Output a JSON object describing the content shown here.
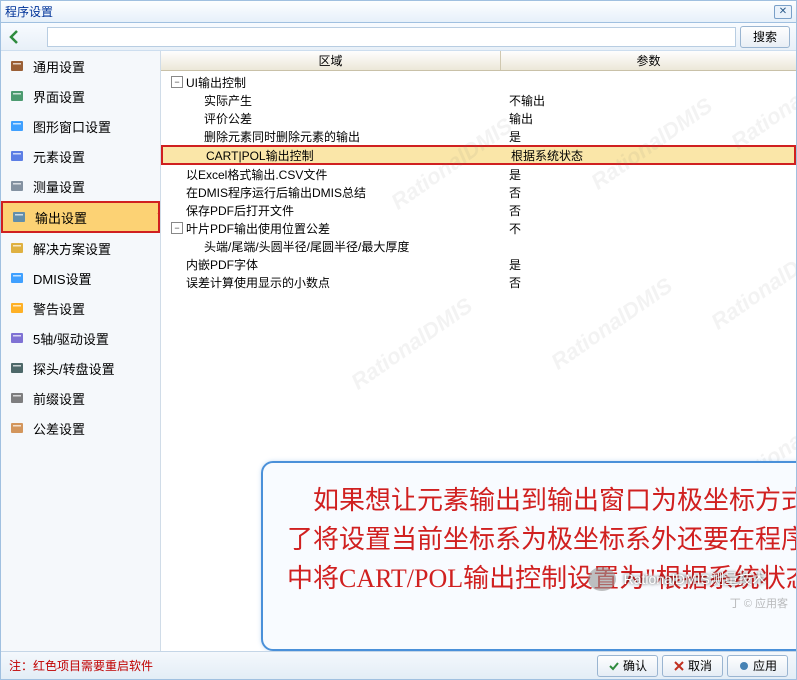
{
  "title": "程序设置",
  "toolbar": {
    "search_btn": "搜索"
  },
  "sidebar": {
    "items": [
      {
        "label": "通用设置"
      },
      {
        "label": "界面设置"
      },
      {
        "label": "图形窗口设置"
      },
      {
        "label": "元素设置"
      },
      {
        "label": "测量设置"
      },
      {
        "label": "输出设置"
      },
      {
        "label": "解决方案设置"
      },
      {
        "label": "DMIS设置"
      },
      {
        "label": "警告设置"
      },
      {
        "label": "5轴/驱动设置"
      },
      {
        "label": "探头/转盘设置"
      },
      {
        "label": "前缀设置"
      },
      {
        "label": "公差设置"
      }
    ],
    "selected_index": 5
  },
  "table": {
    "header_region": "区域",
    "header_param": "参数",
    "rows": [
      {
        "indent": 0,
        "expander": "-",
        "label": "UI输出控制",
        "value": ""
      },
      {
        "indent": 1,
        "expander": "",
        "label": "实际产生",
        "value": "不输出"
      },
      {
        "indent": 1,
        "expander": "",
        "label": "评价公差",
        "value": "输出"
      },
      {
        "indent": 1,
        "expander": "",
        "label": "删除元素同时删除元素的输出",
        "value": "是"
      },
      {
        "indent": 1,
        "expander": "",
        "label": "CART|POL输出控制",
        "value": "根据系统状态",
        "hl": true
      },
      {
        "indent": 0,
        "expander": "",
        "label": "以Excel格式输出.CSV文件",
        "value": "是"
      },
      {
        "indent": 0,
        "expander": "",
        "label": "在DMIS程序运行后输出DMIS总结",
        "value": "否"
      },
      {
        "indent": 0,
        "expander": "",
        "label": "保存PDF后打开文件",
        "value": "否"
      },
      {
        "indent": 0,
        "expander": "-",
        "label": "叶片PDF输出使用位置公差",
        "value": "不"
      },
      {
        "indent": 1,
        "expander": "",
        "label": "头端/尾端/头圆半径/尾圆半径/最大厚度",
        "value": ""
      },
      {
        "indent": 0,
        "expander": "",
        "label": "内嵌PDF字体",
        "value": "是"
      },
      {
        "indent": 0,
        "expander": "",
        "label": "误差计算使用显示的小数点",
        "value": "否"
      }
    ]
  },
  "annotation": "　如果想让元素输出到输出窗口为极坐标方式，除了将设置当前坐标系为极坐标系外还要在程序设置中将CART/POL输出控制设置为\"根据系统状态。",
  "watermark_badge": "RationalDMIS测量技术",
  "extra_text": "丁 © 应用客",
  "footer": {
    "note": "注：红色项目需要重启软件",
    "ok": "确认",
    "cancel": "取消",
    "apply": "应用"
  },
  "icons": {
    "sidebar_colors": [
      "#8B4513",
      "#2E8B57",
      "#1E90FF",
      "#4169E1",
      "#708090",
      "#4682B4",
      "#DAA520",
      "#1E90FF",
      "#FFA500",
      "#6A5ACD",
      "#2F4F4F",
      "#696969",
      "#CD853F"
    ]
  }
}
